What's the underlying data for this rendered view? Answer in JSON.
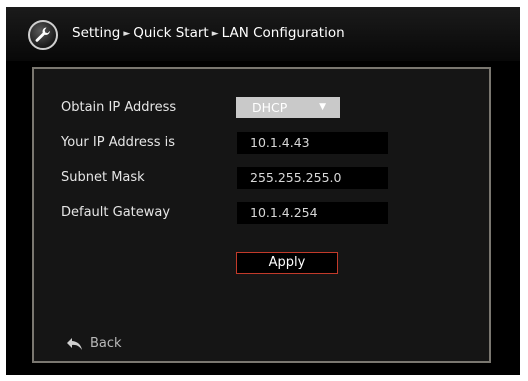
{
  "breadcrumb": {
    "items": [
      "Setting",
      "Quick Start",
      "LAN Configuration"
    ],
    "separator": "►"
  },
  "form": {
    "obtain_ip": {
      "label": "Obtain IP Address",
      "value": "DHCP",
      "arrow": "▼"
    },
    "ip_address": {
      "label": "Your IP Address is",
      "value": "10.1.4.43"
    },
    "subnet_mask": {
      "label": "Subnet Mask",
      "value": "255.255.255.0"
    },
    "gateway": {
      "label": "Default Gateway",
      "value": "10.1.4.254"
    },
    "apply_label": "Apply"
  },
  "back_label": "Back",
  "colors": {
    "background": "#000000",
    "panel_border": "#7a7770",
    "apply_border": "#c23a2a",
    "select_bg": "#c9c9c9"
  },
  "icons": {
    "logo": "wrench-icon",
    "back": "back-arrow-icon"
  }
}
